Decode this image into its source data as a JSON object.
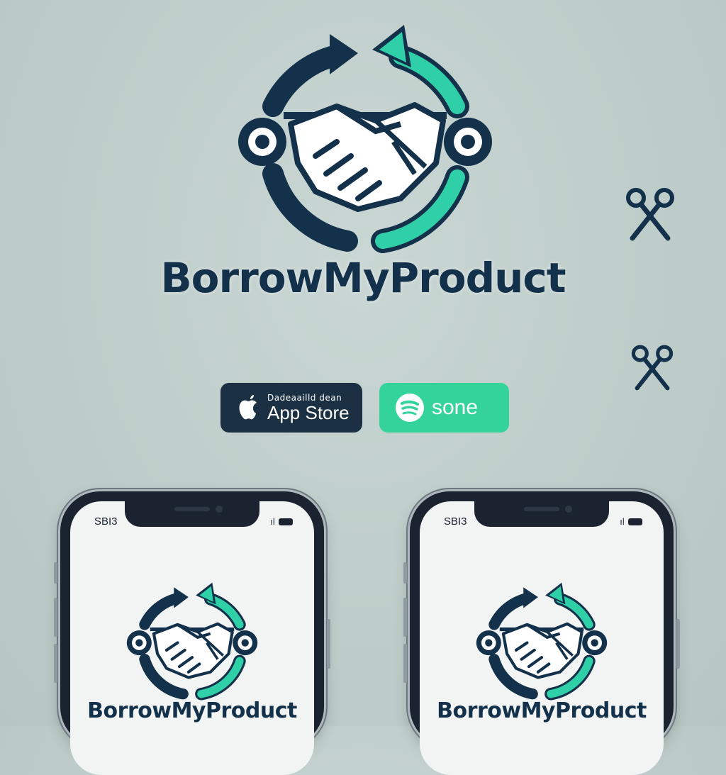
{
  "brand": {
    "name": "BorrowMyProduct"
  },
  "colors": {
    "navy": "#13314a",
    "teal": "#2fd0a8",
    "background": "#c4d2cf"
  },
  "icons": {
    "logo": "handshake-cycle-icon",
    "decor": "scissors-icon"
  },
  "badges": {
    "apple": {
      "small_text": "Dadeaailld dean",
      "store_text": "App Store",
      "icon": "apple-icon"
    },
    "green": {
      "label": "sone",
      "icon": "spotify-like-icon"
    }
  },
  "phones": [
    {
      "time": "SBI3",
      "brand": "BorrowMyProduct"
    },
    {
      "time": "SBI3",
      "brand": "BorrowMyProduct"
    }
  ]
}
